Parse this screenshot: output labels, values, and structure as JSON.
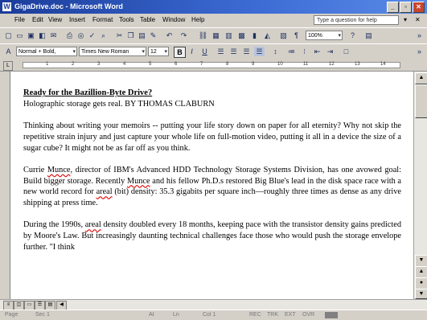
{
  "window": {
    "title": "GigaDrive.doc - Microsoft Word",
    "app_icon": "W"
  },
  "window_buttons": [
    "_",
    "▫",
    "✕"
  ],
  "menu": [
    "File",
    "Edit",
    "View",
    "Insert",
    "Format",
    "Tools",
    "Table",
    "Window",
    "Help"
  ],
  "help_box": {
    "placeholder": "Type a question for help"
  },
  "toolbar1": {
    "zoom": "100%"
  },
  "toolbar2": {
    "style": "Normal + Bold,",
    "font": "Times New Roman",
    "size": "12",
    "bold": "B",
    "italic": "I",
    "underline": "U"
  },
  "ruler": {
    "numbers": [
      "1",
      "2",
      "3",
      "4",
      "5",
      "6",
      "7",
      "8",
      "9",
      "10",
      "11",
      "12",
      "13",
      "14"
    ]
  },
  "document": {
    "heading": "Ready for the Bazillion-Byte Drive?",
    "subheading": "Holographic storage gets real. BY THOMAS CLABURN",
    "p1": "Thinking about writing your memoirs -- putting your life story down on paper for all eternity? Why not skip the repetitive strain injury and just capture your whole life on full-motion video, putting it all in a device the size of a sugar cube? It might not be as far off as you think.",
    "p2_a": "Currie ",
    "p2_name1": "Munce",
    "p2_b": ", director of IBM's Advanced HDD Technology Storage Systems Division, has one avowed goal: Build bigger storage. Recently ",
    "p2_name2": "Munce",
    "p2_c": " and his fellow Ph.D.s restored Big Blue's lead in the disk space race with a new world record for ",
    "p2_areal": "areal",
    "p2_d": " (bit) density: 35.3 gigabits per square inch—roughly three times as dense as any drive shipping at press time.",
    "p3_a": "During the 1990s, ",
    "p3_areal": "areal",
    "p3_b": " density doubled every 18 months, keeping pace with the transistor density gains predicted by Moore's Law. But increasingly daunting technical challenges face those who would push the storage envelope further. \"I think"
  },
  "status": {
    "page": "Page",
    "sec": "Sec 1",
    "at": "At",
    "ln": "Ln",
    "col": "Col 1",
    "rec": "REC",
    "trk": "TRK",
    "ext": "EXT",
    "ovr": "OVR"
  },
  "colors": {
    "titlebar": "#1b3c9a",
    "chrome": "#d4d0c8",
    "spell_error": "#dd0000"
  }
}
